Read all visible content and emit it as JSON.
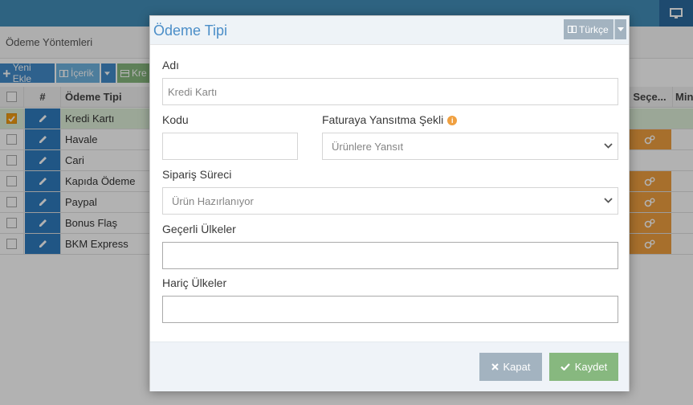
{
  "app": {
    "page_title": "Ödeme Yöntemleri",
    "toolbar": {
      "new_label": "Yeni Ekle",
      "content_label": "İçerik",
      "third_label": "Kre"
    }
  },
  "grid": {
    "headers": {
      "hash": "#",
      "name": "Ödeme Tipi",
      "sec": "Seçe...",
      "min": "Min"
    },
    "rows": [
      {
        "name": "Kredi Kartı",
        "checked": true,
        "has_config": false
      },
      {
        "name": "Havale",
        "checked": false,
        "has_config": true
      },
      {
        "name": "Cari",
        "checked": false,
        "has_config": false
      },
      {
        "name": "Kapıda Ödeme",
        "checked": false,
        "has_config": true
      },
      {
        "name": "Paypal",
        "checked": false,
        "has_config": true
      },
      {
        "name": "Bonus Flaş",
        "checked": false,
        "has_config": true
      },
      {
        "name": "BKM Express",
        "checked": false,
        "has_config": true
      }
    ]
  },
  "modal": {
    "title": "Ödeme Tipi",
    "language": "Türkçe",
    "fields": {
      "name_label": "Adı",
      "name_value": "Kredi Kartı",
      "code_label": "Kodu",
      "code_value": "",
      "invoice_label": "Faturaya Yansıtma Şekli",
      "invoice_value": "Ürünlere Yansıt",
      "order_label": "Sipariş Süreci",
      "order_value": "Ürün Hazırlanıyor",
      "valid_label": "Geçerli Ülkeler",
      "valid_value": "",
      "excluded_label": "Hariç Ülkeler",
      "excluded_value": ""
    },
    "close_label": "Kapat",
    "save_label": "Kaydet"
  },
  "colors": {
    "primary": "#438eb9",
    "success": "#87b87f",
    "secondary": "#a3b3c0",
    "warning": "#f0a040",
    "title": "#4b8ec8"
  }
}
